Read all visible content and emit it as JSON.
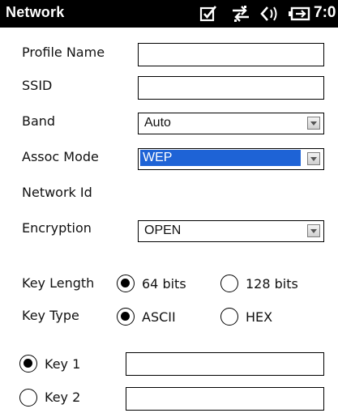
{
  "header": {
    "title": "Network",
    "clock": "7:0",
    "icons": [
      "checkbox-icon",
      "connectivity-icon",
      "volume-icon",
      "battery-icon"
    ]
  },
  "form": {
    "profile_name": {
      "label": "Profile Name",
      "value": ""
    },
    "ssid": {
      "label": "SSID",
      "value": ""
    },
    "band": {
      "label": "Band",
      "value": "Auto"
    },
    "assoc_mode": {
      "label": "Assoc Mode",
      "value": "WEP"
    },
    "network_id": {
      "label": "Network Id"
    },
    "encryption": {
      "label": "Encryption",
      "value": "OPEN"
    },
    "key_length": {
      "label": "Key Length",
      "options": [
        {
          "label": "64 bits",
          "checked": true
        },
        {
          "label": "128 bits",
          "checked": false
        }
      ]
    },
    "key_type": {
      "label": "Key Type",
      "options": [
        {
          "label": "ASCII",
          "checked": true
        },
        {
          "label": "HEX",
          "checked": false
        }
      ]
    },
    "keys": [
      {
        "label": "Key 1",
        "checked": true,
        "value": ""
      },
      {
        "label": "Key 2",
        "checked": false,
        "value": ""
      }
    ]
  },
  "colors": {
    "titlebar": "#000000",
    "selection": "#1e63d6"
  }
}
